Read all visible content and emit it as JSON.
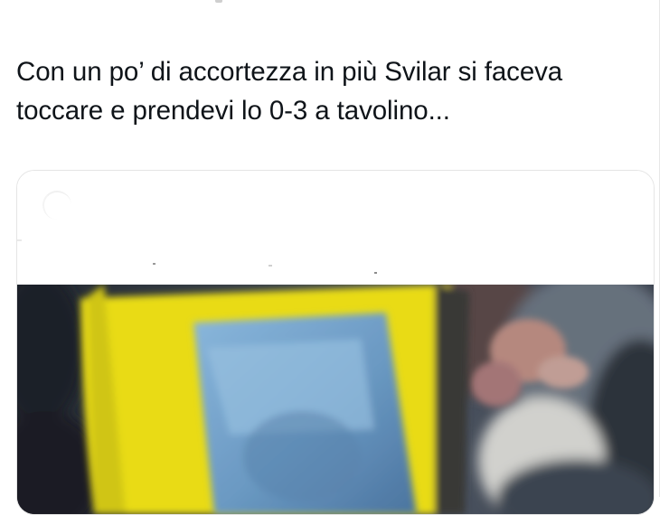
{
  "tweet": {
    "text": "Con un po’ di accortezza in più Svilar si faceva\ntoccare e prendevi lo 0-3 a tavolino..."
  },
  "media": {
    "type": "video",
    "colors": {
      "shirt_yellow": "#f1e313",
      "screen_blue": "#7aaed8",
      "crowd_dark": "#2f3238",
      "skin": "#bb8d83"
    }
  }
}
